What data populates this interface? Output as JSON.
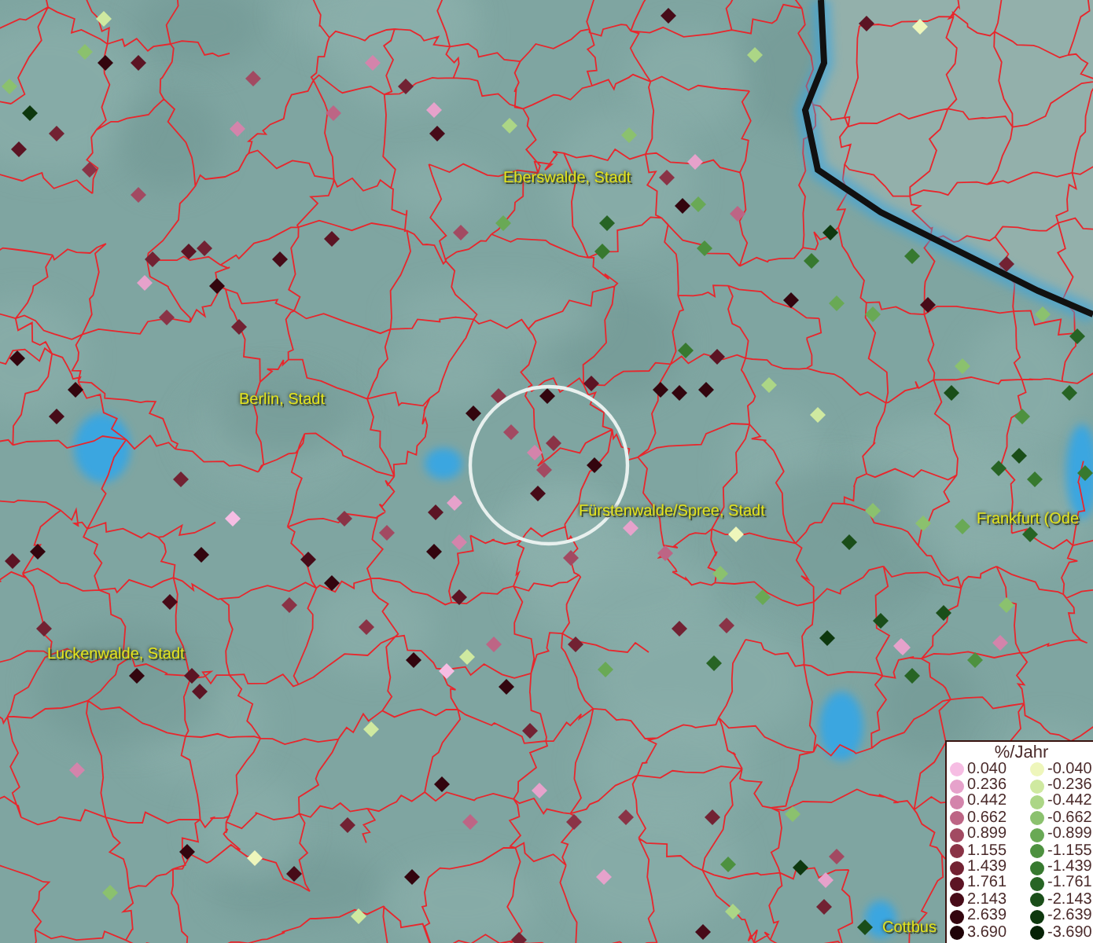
{
  "map": {
    "labels": [
      {
        "kind": "place",
        "text": "Eberswalde, Stadt"
      },
      {
        "kind": "place",
        "text": "Berlin, Stadt"
      },
      {
        "kind": "place",
        "text": "Fürstenwalde/Spree, Stadt"
      },
      {
        "kind": "place",
        "text": "Frankfurt (Ode"
      },
      {
        "kind": "place",
        "text": "Luckenwalde, Stadt"
      },
      {
        "kind": "place",
        "text": "Cottbus"
      }
    ]
  },
  "legend": {
    "title": "%/Jahr",
    "rising": [
      {
        "value": "0.040",
        "color": "#f6bde3"
      },
      {
        "value": "0.236",
        "color": "#e6a2cb"
      },
      {
        "value": "0.442",
        "color": "#d384ab"
      },
      {
        "value": "0.662",
        "color": "#bd6585"
      },
      {
        "value": "0.899",
        "color": "#a24a62"
      },
      {
        "value": "1.155",
        "color": "#8a3346"
      },
      {
        "value": "1.439",
        "color": "#722233"
      },
      {
        "value": "1.761",
        "color": "#5c1424"
      },
      {
        "value": "2.143",
        "color": "#470b18"
      },
      {
        "value": "2.639",
        "color": "#33050e"
      },
      {
        "value": "3.690",
        "color": "#1f0207"
      }
    ],
    "falling": [
      {
        "value": "-0.040",
        "color": "#eef6bb"
      },
      {
        "value": "-0.236",
        "color": "#cfe9a0"
      },
      {
        "value": "-0.442",
        "color": "#acd686"
      },
      {
        "value": "-0.662",
        "color": "#8bc16e"
      },
      {
        "value": "-0.899",
        "color": "#69a955"
      },
      {
        "value": "-1.155",
        "color": "#4d913f"
      },
      {
        "value": "-1.439",
        "color": "#37792f"
      },
      {
        "value": "-1.761",
        "color": "#276424"
      },
      {
        "value": "-2.143",
        "color": "#1a4e19"
      },
      {
        "value": "-2.639",
        "color": "#0e380e"
      },
      {
        "value": "-3.690",
        "color": "#062206"
      }
    ]
  }
}
